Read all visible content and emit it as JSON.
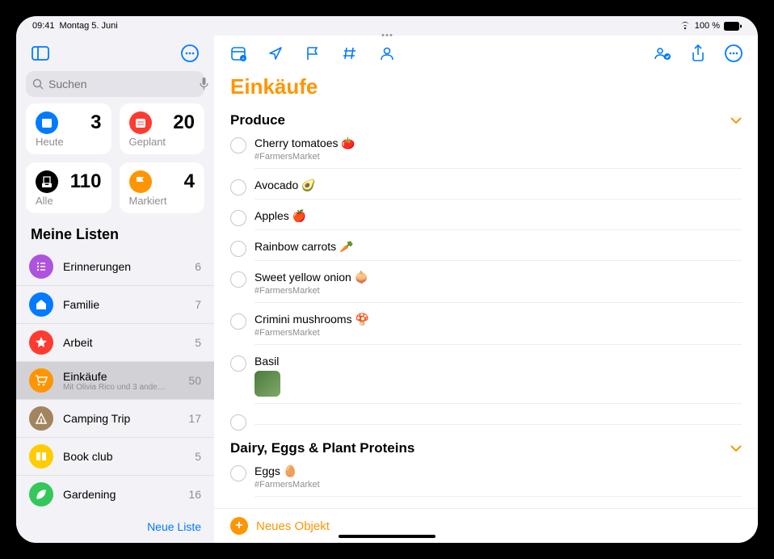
{
  "status": {
    "time": "09:41",
    "date": "Montag 5. Juni",
    "battery": "100 %"
  },
  "sidebar": {
    "search_placeholder": "Suchen",
    "smart": [
      {
        "label": "Heute",
        "count": "3",
        "bg": "#007aff",
        "icon": "calendar"
      },
      {
        "label": "Geplant",
        "count": "20",
        "bg": "#ff3b30",
        "icon": "calendar-lines"
      },
      {
        "label": "Alle",
        "count": "110",
        "bg": "#000",
        "icon": "tray"
      },
      {
        "label": "Markiert",
        "count": "4",
        "bg": "#ff9500",
        "icon": "flag"
      }
    ],
    "lists_header": "Meine Listen",
    "lists": [
      {
        "name": "Erinnerungen",
        "count": "6",
        "color": "#af52de",
        "icon": "list"
      },
      {
        "name": "Familie",
        "count": "7",
        "color": "#007aff",
        "icon": "house"
      },
      {
        "name": "Arbeit",
        "count": "5",
        "color": "#ff3b30",
        "icon": "star"
      },
      {
        "name": "Einkäufe",
        "count": "50",
        "color": "#ff9500",
        "icon": "cart",
        "sub": "Mit Olivia Rico und 3 ande…",
        "selected": true
      },
      {
        "name": "Camping Trip",
        "count": "17",
        "color": "#a2845e",
        "icon": "tent"
      },
      {
        "name": "Book club",
        "count": "5",
        "color": "#ffcc00",
        "icon": "book"
      },
      {
        "name": "Gardening",
        "count": "16",
        "color": "#34c759",
        "icon": "leaf"
      }
    ],
    "new_list": "Neue Liste"
  },
  "main": {
    "title": "Einkäufe",
    "sections": [
      {
        "title": "Produce",
        "items": [
          {
            "title": "Cherry tomatoes",
            "emoji": "🍅",
            "tag": "#FarmersMarket"
          },
          {
            "title": "Avocado",
            "emoji": "🥑"
          },
          {
            "title": "Apples",
            "emoji": "🍎"
          },
          {
            "title": "Rainbow carrots",
            "emoji": "🥕"
          },
          {
            "title": "Sweet yellow onion",
            "emoji": "🧅",
            "tag": "#FarmersMarket"
          },
          {
            "title": "Crimini mushrooms",
            "emoji": "🍄",
            "tag": "#FarmersMarket"
          },
          {
            "title": "Basil",
            "thumb": true
          }
        ]
      },
      {
        "title": "Dairy, Eggs & Plant Proteins",
        "items": [
          {
            "title": "Eggs",
            "emoji": "🥚",
            "tag": "#FarmersMarket"
          }
        ]
      }
    ],
    "new_object": "Neues Objekt"
  }
}
